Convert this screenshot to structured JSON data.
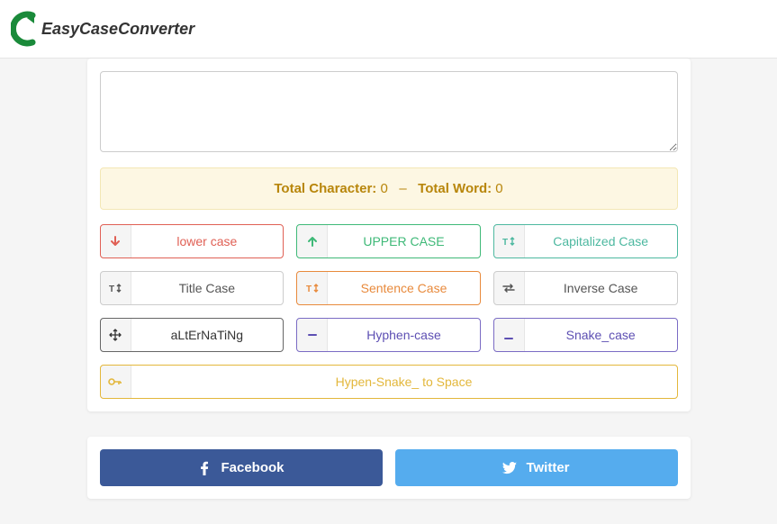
{
  "brand": "EasyCaseConverter",
  "stats": {
    "char_label": "Total Character:",
    "char_value": "0",
    "sep": "–",
    "word_label": "Total Word:",
    "word_value": "0"
  },
  "buttons": {
    "lower": "lower case",
    "upper": "UPPER CASE",
    "capitalized": "Capitalized Case",
    "title": "Title Case",
    "sentence": "Sentence Case",
    "inverse": "Inverse Case",
    "alternating": "aLtErNaTiNg",
    "hyphen": "Hyphen-case",
    "snake": "Snake_case",
    "hyphen_snake_space": "Hypen-Snake_ to Space"
  },
  "share": {
    "facebook": "Facebook",
    "twitter": "Twitter"
  }
}
